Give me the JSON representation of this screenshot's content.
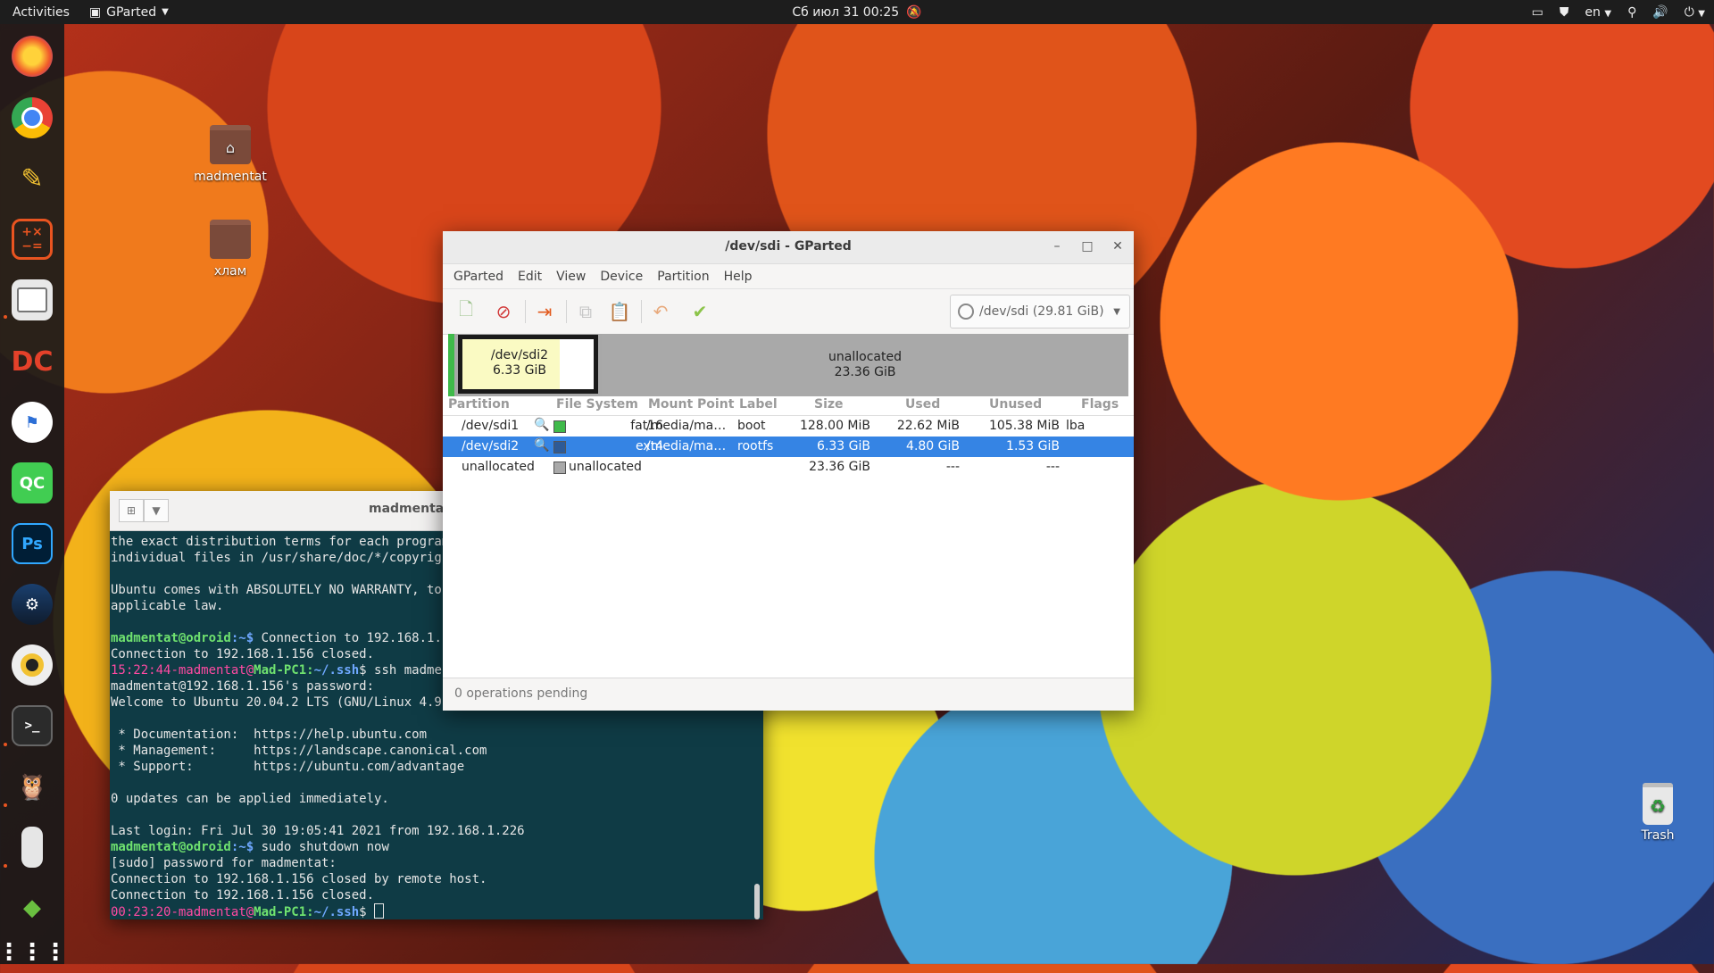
{
  "topbar": {
    "activities": "Activities",
    "app_name": "GParted",
    "clock": "Сб июл 31  00:25",
    "language": "en"
  },
  "desktop": {
    "icons": [
      {
        "label": "madmentat"
      },
      {
        "label": "хлам"
      }
    ],
    "trash": "Trash"
  },
  "dock": {
    "items": [
      "firefox-icon",
      "chrome-icon",
      "text-editor-icon",
      "calculator-icon",
      "files-icon",
      "doublecmd-icon",
      "rescue-icon",
      "qtcreator-icon",
      "photoshop-icon",
      "steam-icon",
      "rhythmbox-icon",
      "terminal-icon",
      "cyberfox-icon",
      "usb-drive-icon",
      "layers-icon",
      "show-apps-icon"
    ],
    "qc_label": "QC",
    "ps_label": "Ps",
    "term_label": ">_"
  },
  "terminal": {
    "title": "madmentat",
    "lines": [
      {
        "text": "the exact distribution terms for each program are described in the"
      },
      {
        "text": "individual files in /usr/share/doc/*/copyright."
      },
      {
        "text": ""
      },
      {
        "text": "Ubuntu comes with ABSOLUTELY NO WARRANTY, to the extent permitted by"
      },
      {
        "text": "applicable law."
      },
      {
        "text": ""
      },
      {
        "prompt": "madmentat@odroid",
        "path": ":~$",
        "text": " Connection to 192.168.1.156 closed."
      },
      {
        "text": "Connection to 192.168.1.156 closed."
      },
      {
        "time": "15:22:44",
        "user": "-madmentat@",
        "host": "Mad-PC1:",
        "dir": "~/.ssh",
        "text": "$ ssh madmentat@192.168.1.156"
      },
      {
        "text": "madmentat@192.168.1.156's password:"
      },
      {
        "text": "Welcome to Ubuntu 20.04.2 LTS (GNU/Linux 4.9.241-102 aarch64)"
      },
      {
        "text": ""
      },
      {
        "text": " * Documentation:  https://help.ubuntu.com"
      },
      {
        "text": " * Management:     https://landscape.canonical.com"
      },
      {
        "text": " * Support:        https://ubuntu.com/advantage"
      },
      {
        "text": ""
      },
      {
        "text": "0 updates can be applied immediately."
      },
      {
        "text": ""
      },
      {
        "text": "Last login: Fri Jul 30 19:05:41 2021 from 192.168.1.226"
      },
      {
        "prompt": "madmentat@odroid",
        "path": ":~$",
        "text": " sudo shutdown now"
      },
      {
        "text": "[sudo] password for madmentat:"
      },
      {
        "text": "Connection to 192.168.1.156 closed by remote host."
      },
      {
        "text": "Connection to 192.168.1.156 closed."
      },
      {
        "time": "00:23:20",
        "user": "-madmentat@",
        "host": "Mad-PC1:",
        "dir": "~/.ssh",
        "text": "$ ",
        "cursor": true
      }
    ]
  },
  "gparted": {
    "title": "/dev/sdi - GParted",
    "menu": [
      "GParted",
      "Edit",
      "View",
      "Device",
      "Partition",
      "Help"
    ],
    "device_selector": "/dev/sdi  (29.81 GiB)",
    "map": {
      "sdi2_name": "/dev/sdi2",
      "sdi2_size": "6.33 GiB",
      "unalloc_name": "unallocated",
      "unalloc_size": "23.36 GiB"
    },
    "columns": [
      "Partition",
      "File System",
      "Mount Point",
      "Label",
      "Size",
      "Used",
      "Unused",
      "Flags"
    ],
    "rows": [
      {
        "partition": "/dev/sdi1",
        "fs": "fat16",
        "mount": "/media/ma…",
        "label": "boot",
        "size": "128.00 MiB",
        "used": "22.62 MiB",
        "unused": "105.38 MiB",
        "flags": "lba",
        "color": "#3fba4a",
        "key": true,
        "selected": false
      },
      {
        "partition": "/dev/sdi2",
        "fs": "ext4",
        "mount": "/media/ma…",
        "label": "rootfs",
        "size": "6.33 GiB",
        "used": "4.80 GiB",
        "unused": "1.53 GiB",
        "flags": "",
        "color": "#2e5a96",
        "key": true,
        "selected": true
      },
      {
        "partition": "unallocated",
        "fs": "unallocated",
        "mount": "",
        "label": "",
        "size": "23.36 GiB",
        "used": "---",
        "unused": "---",
        "flags": "",
        "color": "#a9a9a9",
        "key": false,
        "selected": false
      }
    ],
    "status": "0 operations pending"
  }
}
